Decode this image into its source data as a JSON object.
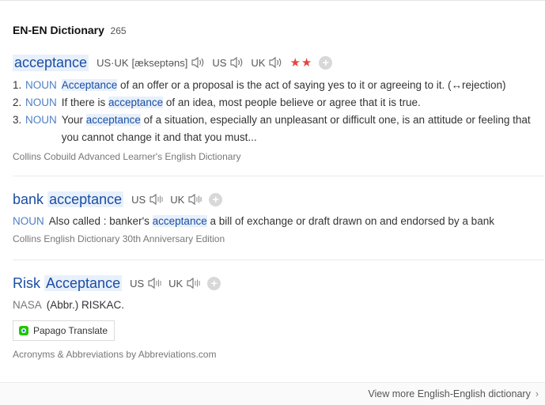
{
  "header": {
    "title": "EN-EN Dictionary",
    "count": "265"
  },
  "entries": [
    {
      "headword": "acceptance",
      "pron_label_1": "US·UK",
      "phonetic": "[ækseptəns]",
      "pron_label_2": "US",
      "pron_label_3": "UK",
      "stars": "★★",
      "definitions": [
        {
          "num": "1.",
          "pos": "NOUN",
          "pre": "",
          "kw": "Acceptance",
          "post": " of an offer or a proposal is the act of saying yes to it or agreeing to it. (↔rejection)"
        },
        {
          "num": "2.",
          "pos": "NOUN",
          "pre": "If there is ",
          "kw": "acceptance",
          "post": " of an idea, most people believe or agree that it is true."
        },
        {
          "num": "3.",
          "pos": "NOUN",
          "pre": "Your ",
          "kw": "acceptance",
          "post": " of a situation, especially an unpleasant or difficult one, is an attitude or feeling that you cannot change it and that you must..."
        }
      ],
      "source": "Collins Cobuild Advanced Learner's English Dictionary"
    },
    {
      "headword_part1": "bank",
      "headword_part2": "acceptance",
      "pron_label_1": "US",
      "pron_label_2": "UK",
      "pos": "NOUN",
      "pre": "Also called : banker's ",
      "kw": "acceptance",
      "post": " a bill of exchange or draft drawn on and endorsed by a bank",
      "source": "Collins English Dictionary 30th Anniversary Edition"
    },
    {
      "headword_part1": "Risk",
      "headword_part2": "Acceptance",
      "pron_label_1": "US",
      "pron_label_2": "UK",
      "pos": "NASA",
      "text": "(Abbr.) RISKAC.",
      "papago_label": "Papago Translate",
      "source": "Acronyms & Abbreviations by Abbreviations.com"
    }
  ],
  "footer": {
    "more_label": "View more English-English dictionary",
    "chevron": "›"
  },
  "colors": {
    "link": "#1b4ea3",
    "pos": "#4d7fc4",
    "highlight": "#e8f0fb",
    "star": "#e1483f"
  }
}
